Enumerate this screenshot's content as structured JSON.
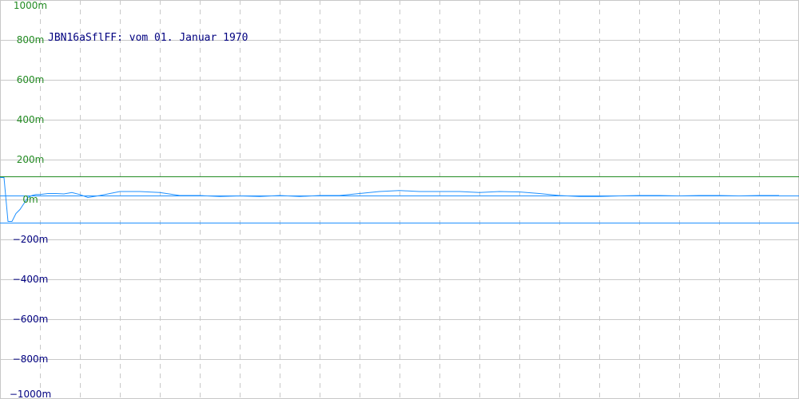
{
  "chart_data": {
    "type": "line",
    "title": "JBN16aSflFF: vom 01. Januar 1970",
    "ylim": [
      -1,
      1
    ],
    "y_ticks": [
      {
        "value": 1.0,
        "label": "1000m"
      },
      {
        "value": 0.8,
        "label": "800m"
      },
      {
        "value": 0.6,
        "label": "600m"
      },
      {
        "value": 0.4,
        "label": "400m"
      },
      {
        "value": 0.2,
        "label": "200m"
      },
      {
        "value": 0.0,
        "label": "0m"
      },
      {
        "value": -0.2,
        "label": "−200m"
      },
      {
        "value": -0.4,
        "label": "−400m"
      },
      {
        "value": -0.6,
        "label": "−600m"
      },
      {
        "value": -0.8,
        "label": "−800m"
      },
      {
        "value": -1.0,
        "label": "−1000m"
      }
    ],
    "grid": true,
    "reference_lines": [
      {
        "value": 0.115,
        "color": "#228b22"
      },
      {
        "value": 0.02,
        "color": "#1e90ff"
      },
      {
        "value": -0.115,
        "color": "#1e90ff"
      }
    ],
    "series": [
      {
        "color": "#1e90ff",
        "x": [
          0,
          1,
          2,
          3,
          4,
          5,
          6,
          7,
          8,
          9,
          10,
          12,
          14,
          16,
          18,
          20,
          22,
          25,
          30,
          35,
          40,
          45,
          50,
          55,
          60,
          65,
          70,
          75,
          80,
          85,
          90,
          95,
          100,
          105,
          110,
          115,
          120,
          125,
          130,
          135,
          140,
          145,
          150,
          155,
          160,
          165,
          170,
          175,
          180,
          185,
          190,
          195
        ],
        "y": [
          0.11,
          0.11,
          -0.11,
          -0.11,
          -0.07,
          -0.05,
          -0.02,
          0.01,
          0.02,
          0.025,
          0.025,
          0.03,
          0.03,
          0.028,
          0.035,
          0.025,
          0.01,
          0.02,
          0.04,
          0.04,
          0.035,
          0.02,
          0.02,
          0.015,
          0.018,
          0.015,
          0.02,
          0.015,
          0.02,
          0.02,
          0.03,
          0.04,
          0.045,
          0.04,
          0.04,
          0.04,
          0.035,
          0.04,
          0.038,
          0.03,
          0.02,
          0.015,
          0.015,
          0.018,
          0.02,
          0.02,
          0.018,
          0.02,
          0.02,
          0.018,
          0.02,
          0.02
        ]
      }
    ],
    "x_range": [
      0,
      200
    ]
  },
  "colors": {
    "axis_label": "#228b22",
    "axis_label_negative": "#000080",
    "grid": "#c8c8c8",
    "title": "#000080"
  }
}
